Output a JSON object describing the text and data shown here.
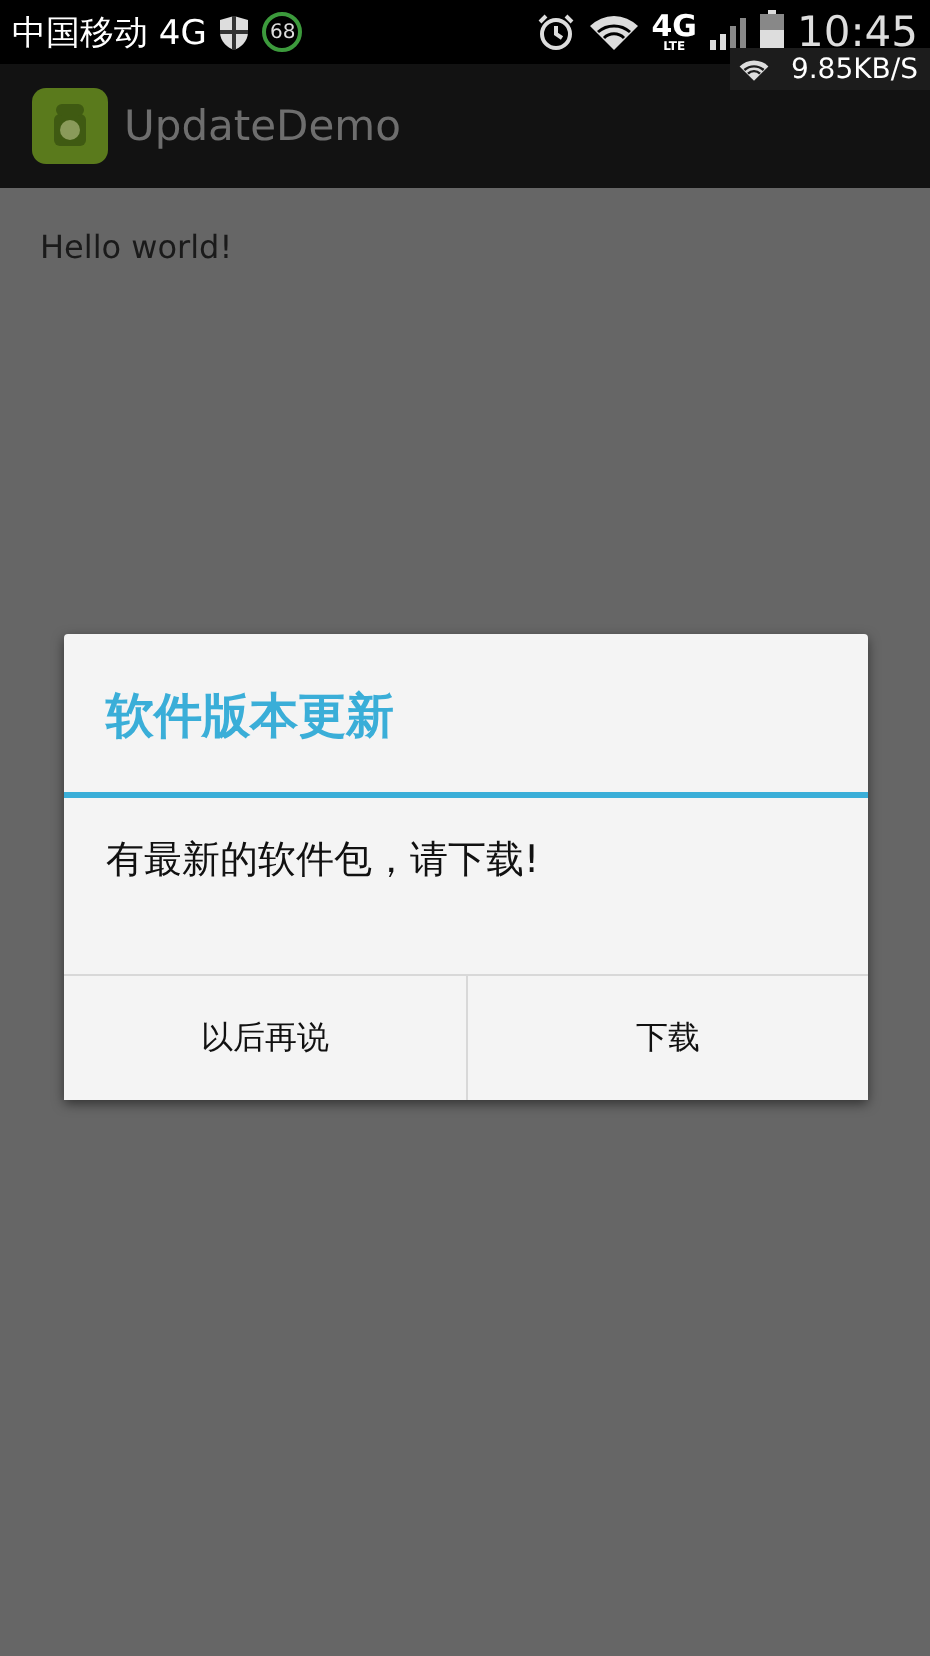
{
  "status_bar": {
    "carrier": "中国移动 4G",
    "badge": "68",
    "network_type": "4G",
    "network_sub": "LTE",
    "time": "10:45",
    "speed": "9.85KB/S"
  },
  "action_bar": {
    "title": "UpdateDemo"
  },
  "content": {
    "text": "Hello world!"
  },
  "dialog": {
    "title": "软件版本更新",
    "message": "有最新的软件包，请下载!",
    "buttons": [
      {
        "label": "以后再说"
      },
      {
        "label": "下载"
      }
    ]
  }
}
